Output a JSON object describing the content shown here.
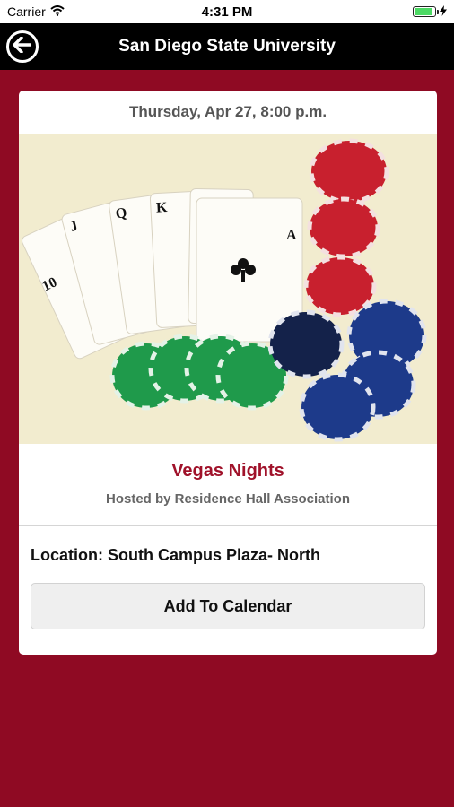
{
  "status_bar": {
    "carrier": "Carrier",
    "time": "4:31 PM",
    "battery_level": 0.9,
    "icons": [
      "wifi-icon",
      "battery-icon",
      "charging-bolt-icon"
    ]
  },
  "nav": {
    "title": "San Diego State University",
    "back_icon": "back-arrow-icon"
  },
  "event": {
    "date": "Thursday, Apr 27, 8:00 p.m.",
    "title": "Vegas Nights",
    "host": "Hosted by Residence Hall Association",
    "location": "Location: South Campus Plaza- North",
    "add_to_calendar_label": "Add To Calendar",
    "image_cards": [
      "10",
      "J",
      "Q",
      "K",
      "A",
      "A"
    ]
  },
  "colors": {
    "background": "#8f0a23",
    "nav_bar": "#000000",
    "title_accent": "#a0122a",
    "battery": "#4cd964"
  }
}
